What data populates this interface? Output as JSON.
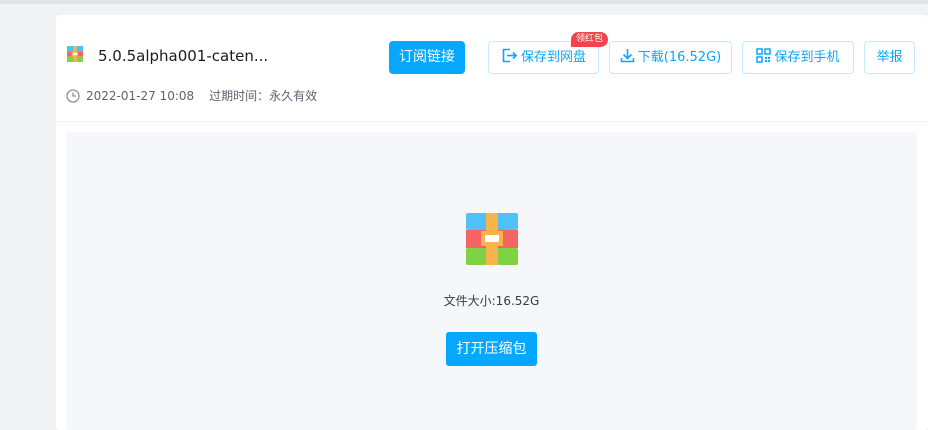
{
  "file": {
    "name": "5.0.5alpha001-caten...",
    "date": "2022-01-27 10:08",
    "expire_label": "过期时间：",
    "expire_value": "永久有效",
    "size_text": "文件大小:16.52G"
  },
  "toolbar": {
    "subscribe": "订阅链接",
    "save_to_disk": "保存到网盘",
    "red_packet_badge": "领红包",
    "download": "下载(16.52G)",
    "save_to_phone": "保存到手机",
    "report": "举报"
  },
  "preview": {
    "open_button": "打开压缩包"
  },
  "icons": {
    "file": "archive-icon",
    "clock": "clock-icon",
    "save": "save-to-disk-icon",
    "download": "download-icon",
    "qr": "qr-code-icon"
  },
  "colors": {
    "primary": "#06a7ff",
    "badge": "#f5434b",
    "archive_top": "#4fc1f5",
    "archive_middle": "#f46462",
    "archive_bottom": "#7fd342",
    "archive_strap": "#f7b44a"
  }
}
